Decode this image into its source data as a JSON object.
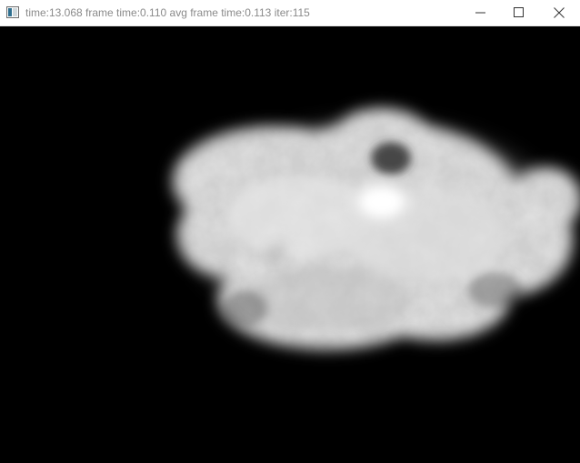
{
  "window": {
    "title": "time:13.068 frame time:0.110 avg frame time:0.113 iter:115",
    "controls": {
      "minimize_icon": "minimize-icon",
      "maximize_icon": "maximize-icon",
      "close_icon": "close-icon"
    }
  },
  "render": {
    "background": "#000000",
    "cloud_color": "#ffffff"
  }
}
